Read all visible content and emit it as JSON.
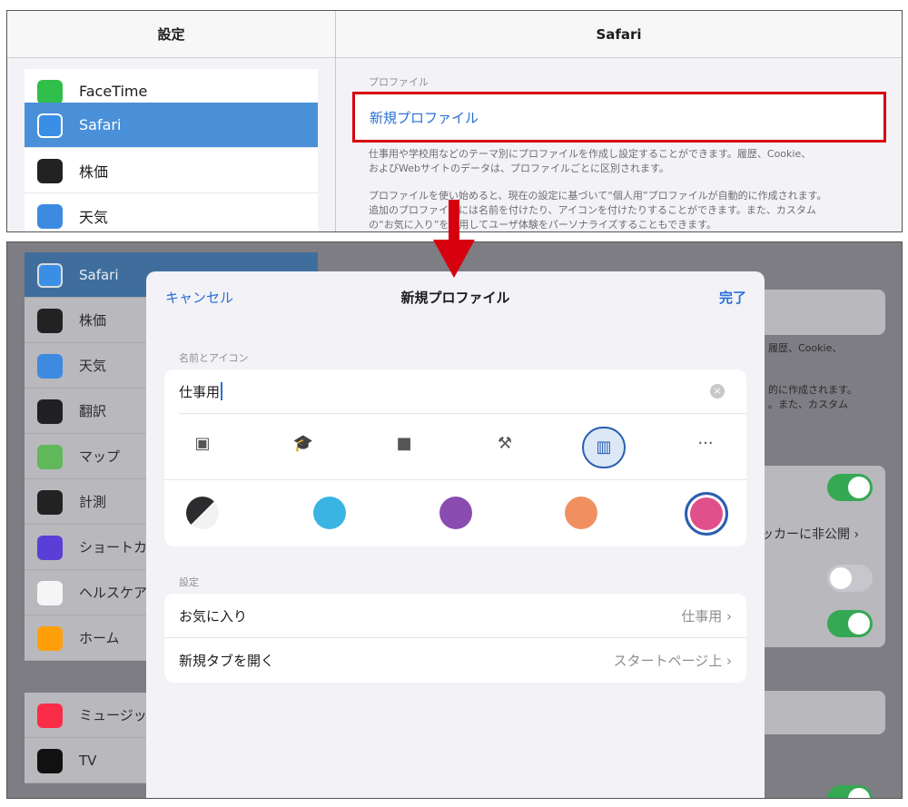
{
  "top": {
    "left_title": "設定",
    "right_title": "Safari",
    "items": [
      {
        "label": "FaceTime",
        "icon": "facetime-icon",
        "color": "#2fbf4a"
      },
      {
        "label": "Safari",
        "icon": "safari-icon",
        "color": "#3a8ee6"
      },
      {
        "label": "株価",
        "icon": "stocks-icon",
        "color": "#222222"
      },
      {
        "label": "天気",
        "icon": "weather-icon",
        "color": "#3d8be0"
      }
    ],
    "section_label": "プロファイル",
    "new_profile": "新規プロファイル",
    "desc1a": "仕事用や学校用などのテーマ別にプロファイルを作成し設定することができます。履歴、Cookie、",
    "desc1b": "およびWebサイトのデータは、プロファイルごとに区別されます。",
    "desc2a": "プロファイルを使い始めると、現在の設定に基づいて“個人用”プロファイルが自動的に作成されます。",
    "desc2b": "追加のプロファイルには名前を付けたり、アイコンを付けたりすることができます。また、カスタム",
    "desc2c": "の“お気に入り”を使用してユーザ体験をパーソナライズすることもできます。"
  },
  "bottom": {
    "items": [
      {
        "label": "Safari",
        "icon": "safari-icon",
        "color": "#3a8ee6"
      },
      {
        "label": "株価",
        "icon": "stocks-icon",
        "color": "#222222"
      },
      {
        "label": "天気",
        "icon": "weather-icon",
        "color": "#3d8be0"
      },
      {
        "label": "翻訳",
        "icon": "translate-icon",
        "color": "#1f1f24"
      },
      {
        "label": "マップ",
        "icon": "maps-icon",
        "color": "#5fb85a"
      },
      {
        "label": "計測",
        "icon": "measure-icon",
        "color": "#222222"
      },
      {
        "label": "ショートカ",
        "icon": "shortcuts-icon",
        "color": "#5a3fd6"
      },
      {
        "label": "ヘルスケア",
        "icon": "health-icon",
        "color": "#ffffff"
      },
      {
        "label": "ホーム",
        "icon": "home-icon",
        "color": "#ff9f0a"
      },
      {
        "label": "ミュージッ",
        "icon": "music-icon",
        "color": "#fa2d48"
      },
      {
        "label": "TV",
        "icon": "tv-icon",
        "color": "#111111"
      }
    ],
    "bg_text1": "履歴、Cookie、",
    "bg_text2": "的に作成されます。",
    "bg_text3": "。また、カスタム",
    "bg_tracker": "ッカーに非公開 ›"
  },
  "modal": {
    "cancel": "キャンセル",
    "title": "新規プロファイル",
    "done": "完了",
    "name_section": "名前とアイコン",
    "name_value": "仕事用",
    "icons": [
      "id-badge-icon",
      "graduation-cap-icon",
      "briefcase-icon",
      "hammer-icon",
      "building-icon",
      "more-icon"
    ],
    "icon_glyphs": [
      "▣",
      "🎓",
      "■",
      "⚒",
      "▥",
      "···"
    ],
    "colors": [
      "#2c2c2e",
      "#3ab4e3",
      "#8a4cb0",
      "#f09060",
      "#e0508a"
    ],
    "settings_section": "設定",
    "rows": [
      {
        "label": "お気に入り",
        "value": "仕事用"
      },
      {
        "label": "新規タブを開く",
        "value": "スタートページ上"
      }
    ]
  }
}
